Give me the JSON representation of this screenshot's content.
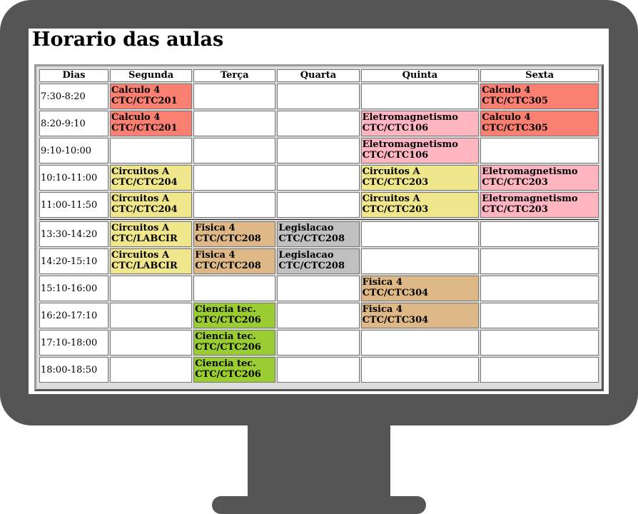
{
  "page": {
    "title": "Horario das aulas"
  },
  "colors": {
    "calculo": "#fa8072",
    "eletromagnetismo": "#ffb6c1",
    "circuitos": "#f0e68c",
    "fisica": "#deb887",
    "legislacao": "#c0c0c0",
    "ciencia": "#9acd32",
    "empty": "#ffffff",
    "monitor": "#555555"
  },
  "schedule": {
    "headers": [
      "Dias",
      "Segunda",
      "Terça",
      "Quarta",
      "Quinta",
      "Sexta"
    ],
    "rows": [
      {
        "time": "7:30-8:20",
        "cells": [
          {
            "name": "Calculo 4",
            "room": "CTC/CTC201",
            "color": "calculo"
          },
          null,
          null,
          null,
          {
            "name": "Calculo 4",
            "room": "CTC/CTC305",
            "color": "calculo"
          }
        ]
      },
      {
        "time": "8:20-9:10",
        "cells": [
          {
            "name": "Calculo 4",
            "room": "CTC/CTC201",
            "color": "calculo"
          },
          null,
          null,
          {
            "name": "Eletromagnetismo",
            "room": "CTC/CTC106",
            "color": "eletromagnetismo"
          },
          {
            "name": "Calculo 4",
            "room": "CTC/CTC305",
            "color": "calculo"
          }
        ]
      },
      {
        "time": "9:10-10:00",
        "cells": [
          null,
          null,
          null,
          {
            "name": "Eletromagnetismo",
            "room": "CTC/CTC106",
            "color": "eletromagnetismo"
          },
          null
        ]
      },
      {
        "time": "10:10-11:00",
        "cells": [
          {
            "name": "Circuitos A",
            "room": "CTC/CTC204",
            "color": "circuitos"
          },
          null,
          null,
          {
            "name": "Circuitos A",
            "room": "CTC/CTC203",
            "color": "circuitos"
          },
          {
            "name": "Eletromagnetismo",
            "room": "CTC/CTC203",
            "color": "eletromagnetismo"
          }
        ]
      },
      {
        "time": "11:00-11:50",
        "cells": [
          {
            "name": "Circuitos A",
            "room": "CTC/CTC204",
            "color": "circuitos"
          },
          null,
          null,
          {
            "name": "Circuitos A",
            "room": "CTC/CTC203",
            "color": "circuitos"
          },
          {
            "name": "Eletromagnetismo",
            "room": "CTC/CTC203",
            "color": "eletromagnetismo"
          }
        ],
        "break_after": true
      },
      {
        "time": "13:30-14:20",
        "cells": [
          {
            "name": "Circuitos A",
            "room": "CTC/LABCIR",
            "color": "circuitos"
          },
          {
            "name": "Fisica 4",
            "room": "CTC/CTC208",
            "color": "fisica"
          },
          {
            "name": "Legislacao",
            "room": "CTC/CTC208",
            "color": "legislacao"
          },
          null,
          null
        ]
      },
      {
        "time": "14:20-15:10",
        "cells": [
          {
            "name": "Circuitos A",
            "room": "CTC/LABCIR",
            "color": "circuitos"
          },
          {
            "name": "Fisica 4",
            "room": "CTC/CTC208",
            "color": "fisica"
          },
          {
            "name": "Legislacao",
            "room": "CTC/CTC208",
            "color": "legislacao"
          },
          null,
          null
        ]
      },
      {
        "time": "15:10-16:00",
        "cells": [
          null,
          null,
          null,
          {
            "name": "Fisica 4",
            "room": "CTC/CTC304",
            "color": "fisica"
          },
          null
        ]
      },
      {
        "time": "16:20-17:10",
        "cells": [
          null,
          {
            "name": "Ciencia tec.",
            "room": "CTC/CTC206",
            "color": "ciencia"
          },
          null,
          {
            "name": "Fisica 4",
            "room": "CTC/CTC304",
            "color": "fisica"
          },
          null
        ]
      },
      {
        "time": "17:10-18:00",
        "cells": [
          null,
          {
            "name": "Ciencia tec.",
            "room": "CTC/CTC206",
            "color": "ciencia"
          },
          null,
          null,
          null
        ]
      },
      {
        "time": "18:00-18:50",
        "cells": [
          null,
          {
            "name": "Ciencia tec.",
            "room": "CTC/CTC206",
            "color": "ciencia"
          },
          null,
          null,
          null
        ]
      }
    ]
  }
}
